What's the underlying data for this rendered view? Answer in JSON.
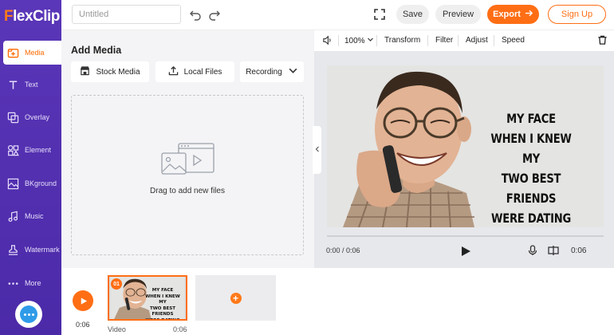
{
  "app": {
    "logo_first": "F",
    "logo_rest": "lexClip",
    "title_placeholder": "Untitled"
  },
  "sidebar": {
    "items": [
      {
        "label": "Media",
        "icon": "media-add-icon",
        "active": true
      },
      {
        "label": "Text",
        "icon": "text-icon"
      },
      {
        "label": "Overlay",
        "icon": "overlay-icon"
      },
      {
        "label": "Element",
        "icon": "element-icon"
      },
      {
        "label": "BKground",
        "icon": "background-icon"
      },
      {
        "label": "Music",
        "icon": "music-icon"
      },
      {
        "label": "Watermark",
        "icon": "watermark-icon"
      },
      {
        "label": "More",
        "icon": "more-dots-icon"
      }
    ]
  },
  "header": {
    "save_label": "Save",
    "preview_label": "Preview",
    "export_label": "Export",
    "signup_label": "Sign Up"
  },
  "media": {
    "title": "Add Media",
    "stock_label": "Stock Media",
    "local_label": "Local Files",
    "recording_label": "Recording",
    "drop_text": "Drag to add new files"
  },
  "preview": {
    "zoom": "100%",
    "transform_label": "Transform",
    "filter_label": "Filter",
    "adjust_label": "Adjust",
    "speed_label": "Speed",
    "meme_lines": [
      "MY FACE",
      "WHEN I KNEW MY",
      "TWO BEST FRIENDS",
      "WERE DATING"
    ],
    "time_current": "0:00 / 0:06",
    "duration": "0:06"
  },
  "timeline": {
    "total": "0:06",
    "clip_number": "01",
    "clip_label": "Video",
    "clip_duration": "0:06"
  },
  "colors": {
    "accent": "#ff6e14",
    "sidebar": "#4b2aa8"
  }
}
